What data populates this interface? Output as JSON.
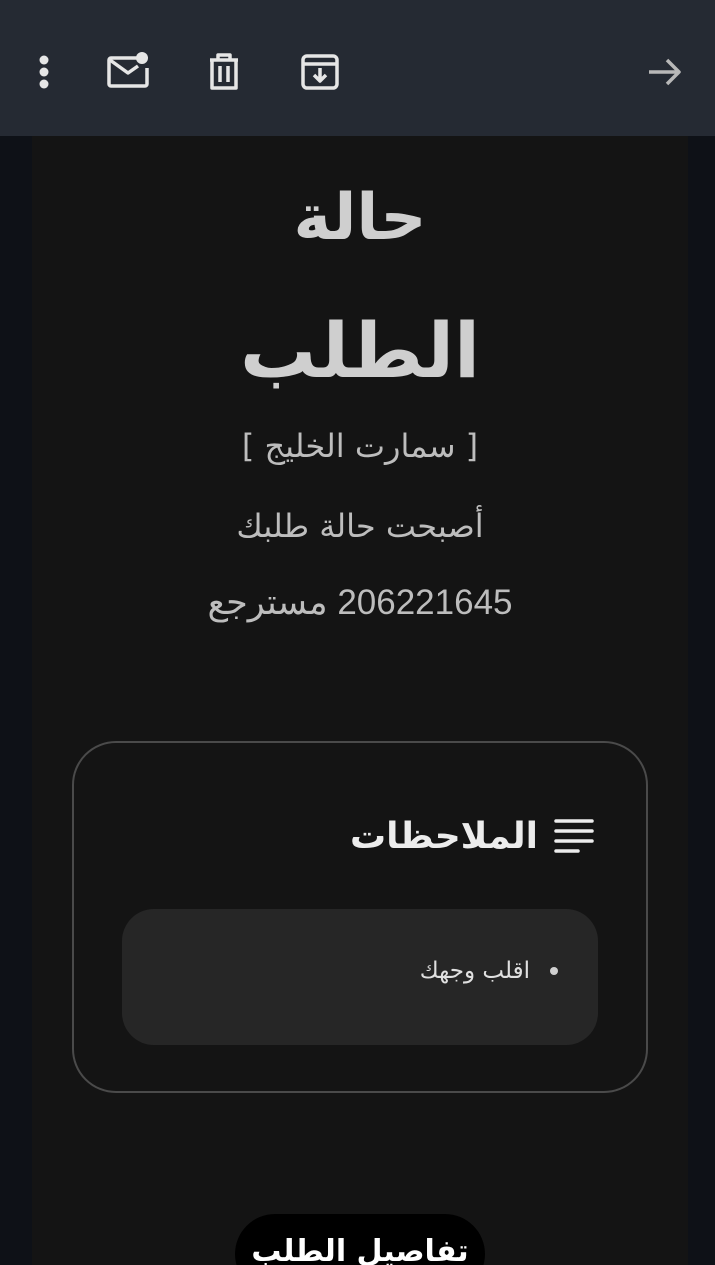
{
  "toolbar": {
    "icons": [
      "more-vert-icon",
      "mark-unread-icon",
      "delete-icon",
      "archive-icon",
      "forward-arrow-icon"
    ]
  },
  "email": {
    "title_line1": "حالة",
    "title_line2": "الطلب",
    "brand": "[ سمارت الخليج ]",
    "became_text": "أصبحت حالة طلبك",
    "status_text": "206221645 مسترجع",
    "notes": {
      "heading": "الملاحظات",
      "items": [
        "اقلب وجهك"
      ]
    },
    "details_button": "تفاصيل الطلب"
  },
  "colors": {
    "toolbar_bg": "#252a33",
    "content_bg": "#141414",
    "notes_box_bg": "#262626"
  }
}
